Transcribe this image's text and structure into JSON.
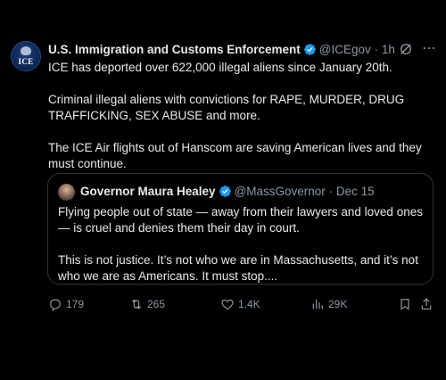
{
  "post": {
    "author": {
      "display_name": "U.S. Immigration and Customs Enforcement",
      "handle": "@ICEgov",
      "separator": "·",
      "time": "1h",
      "avatar_text": "ICE",
      "verified_icon": "verified-badge-icon"
    },
    "body": [
      "ICE has deported over 622,000 illegal aliens since January 20th.",
      "Criminal illegal aliens with convictions for RAPE, MURDER, DRUG TRAFFICKING, SEX ABUSE and more.",
      "The ICE Air flights out of Hanscom are saving American lives and they must continue."
    ],
    "header_icons": [
      "grok-icon",
      "more-icon"
    ]
  },
  "quote": {
    "author": {
      "display_name": "Governor Maura Healey",
      "handle": "@MassGovernor",
      "separator": "·",
      "time": "Dec 15"
    },
    "body": [
      "Flying people out of state — away from their lawyers and loved ones — is cruel and denies them their day in court.",
      "This is not justice. It’s not who we are in Massachusetts, and it’s not who we are as Americans. It must stop...."
    ]
  },
  "actions": {
    "replies": "179",
    "reposts": "265",
    "likes": "1.4K",
    "views": "29K",
    "icons": [
      "reply-icon",
      "repost-icon",
      "like-icon",
      "views-icon",
      "bookmark-icon",
      "share-icon"
    ]
  },
  "colors": {
    "background": "#000000",
    "text": "#e7e9ea",
    "muted": "#8b98a5",
    "verified": "#1d9bf0",
    "border": "#2f3336"
  }
}
